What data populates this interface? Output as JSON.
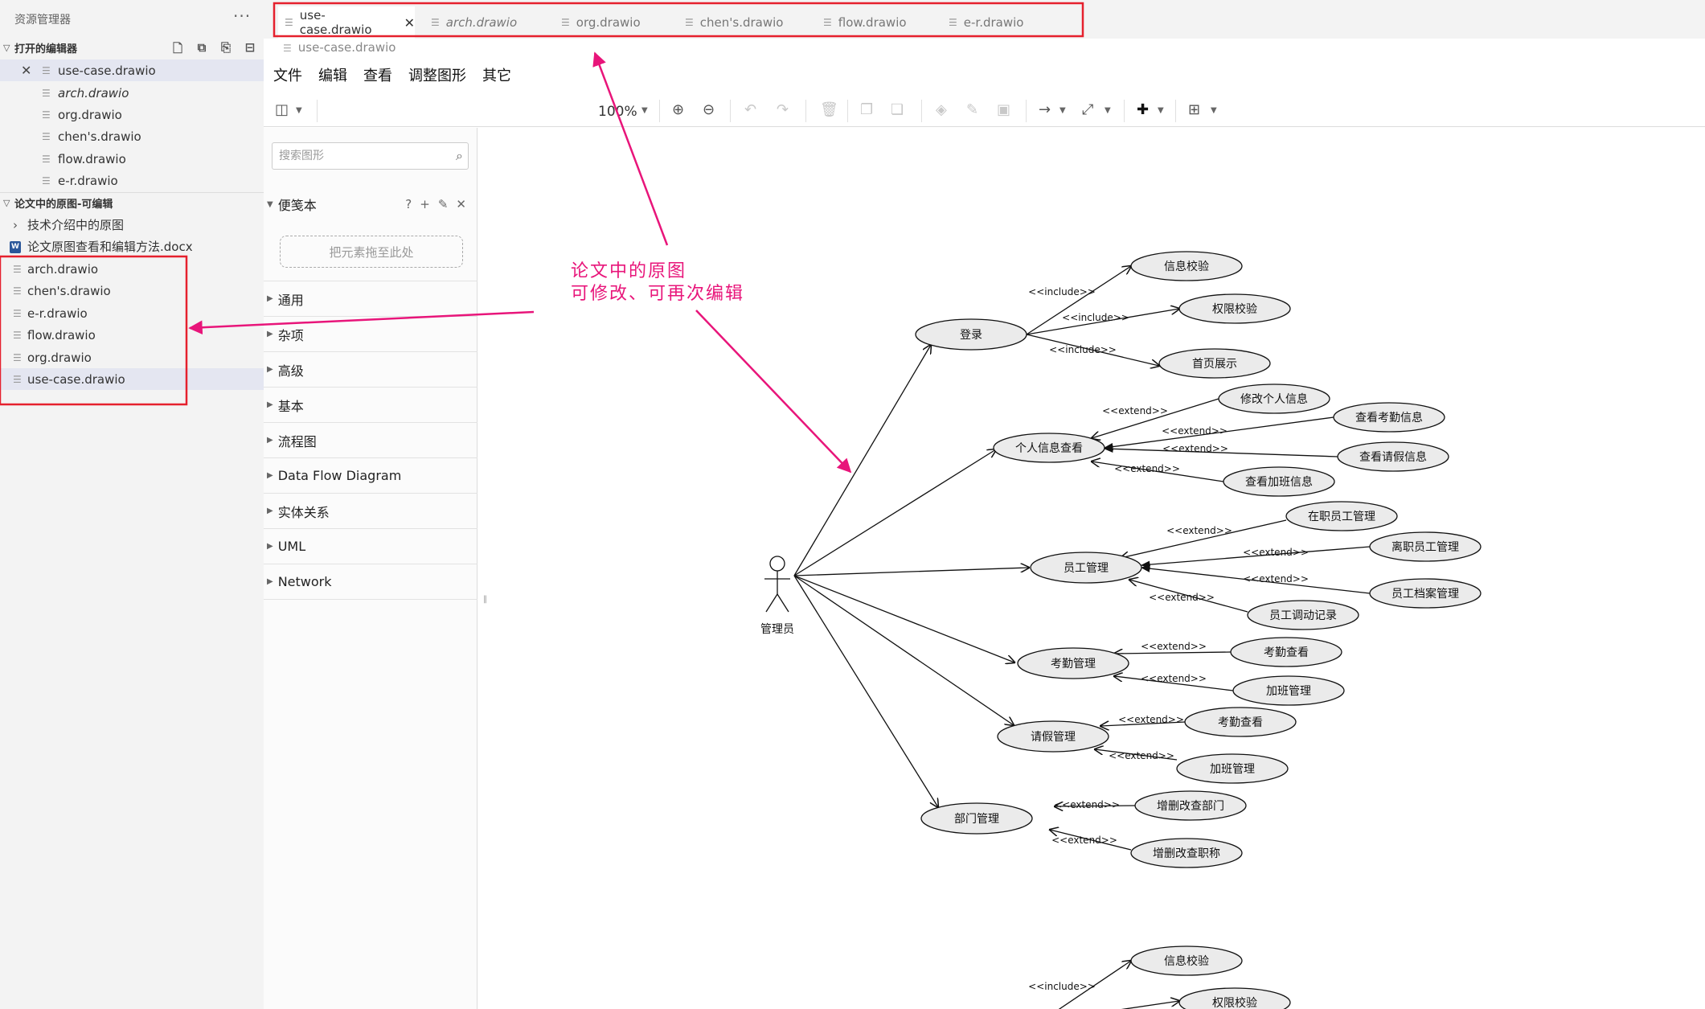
{
  "explorer": {
    "title": "资源管理器",
    "more": "···",
    "open_editors": {
      "header": "打开的编辑器",
      "files": [
        {
          "name": "use-case.drawio",
          "italic": false,
          "selected": true
        },
        {
          "name": "arch.drawio",
          "italic": true,
          "selected": false
        },
        {
          "name": "org.drawio",
          "italic": false,
          "selected": false
        },
        {
          "name": "chen's.drawio",
          "italic": false,
          "selected": false
        },
        {
          "name": "flow.drawio",
          "italic": false,
          "selected": false
        },
        {
          "name": "e-r.drawio",
          "italic": false,
          "selected": false
        }
      ]
    },
    "workspace": {
      "header": "论文中的原图-可编辑",
      "folder": "技术介绍中的原图",
      "docx": "论文原图查看和编辑方法.docx",
      "files": [
        "arch.drawio",
        "chen's.drawio",
        "e-r.drawio",
        "flow.drawio",
        "org.drawio",
        "use-case.drawio"
      ]
    }
  },
  "tabs": [
    {
      "label": "use-case.drawio",
      "italic": false,
      "active": true
    },
    {
      "label": "arch.drawio",
      "italic": true,
      "active": false
    },
    {
      "label": "org.drawio",
      "italic": false,
      "active": false
    },
    {
      "label": "chen's.drawio",
      "italic": false,
      "active": false
    },
    {
      "label": "flow.drawio",
      "italic": false,
      "active": false
    },
    {
      "label": "e-r.drawio",
      "italic": false,
      "active": false
    }
  ],
  "breadcrumb": "use-case.drawio",
  "menu": [
    "文件",
    "编辑",
    "查看",
    "调整图形",
    "其它"
  ],
  "toolbar": {
    "zoom": "100%"
  },
  "shapes": {
    "search_placeholder": "搜索图形",
    "scratchpad": "便笺本",
    "scratch_actions": [
      "?",
      "+",
      "✎",
      "✕"
    ],
    "drop_hint": "把元素拖至此处",
    "libraries": [
      "通用",
      "杂项",
      "高级",
      "基本",
      "流程图",
      "Data Flow Diagram",
      "实体关系",
      "UML",
      "Network"
    ]
  },
  "annotation": {
    "line1": "论文中的原图",
    "line2": "可修改、可再次编辑",
    "color": "#e8157a"
  },
  "diagram": {
    "actor": "管理员",
    "login": "登录",
    "login_children": [
      {
        "label": "信息校验",
        "rel": "<<include>>"
      },
      {
        "label": "权限校验",
        "rel": "<<include>>"
      },
      {
        "label": "首页展示",
        "rel": "<<include>>"
      }
    ],
    "personal": "个人信息查看",
    "personal_children": [
      {
        "label": "修改个人信息",
        "rel": "<<extend>>"
      },
      {
        "label": "查看考勤信息",
        "rel": "<<extend>>"
      },
      {
        "label": "查看请假信息",
        "rel": "<<extend>>"
      },
      {
        "label": "查看加班信息",
        "rel": "<<extend>>"
      }
    ],
    "staff": "员工管理",
    "staff_children": [
      {
        "label": "在职员工管理",
        "rel": "<<extend>>"
      },
      {
        "label": "离职员工管理",
        "rel": "<<extend>>"
      },
      {
        "label": "员工档案管理",
        "rel": "<<extend>>"
      },
      {
        "label": "员工调动记录",
        "rel": "<<extend>>"
      }
    ],
    "attendance": "考勤管理",
    "attendance_children": [
      {
        "label": "考勤查看",
        "rel": "<<extend>>"
      },
      {
        "label": "加班管理",
        "rel": "<<extend>>"
      }
    ],
    "leave": "请假管理",
    "leave_children": [
      {
        "label": "考勤查看",
        "rel": "<<extend>>"
      },
      {
        "label": "加班管理",
        "rel": "<<extend>>"
      }
    ],
    "dept": "部门管理",
    "dept_children": [
      {
        "label": "增删改查部门",
        "rel": "<<extend>>"
      },
      {
        "label": "增删改查职称",
        "rel": "<<extend>>"
      }
    ],
    "bottom_children": [
      {
        "label": "信息校验",
        "rel": "<<include>>"
      },
      {
        "label": "权限校验",
        "rel": "<<include>>"
      }
    ]
  }
}
